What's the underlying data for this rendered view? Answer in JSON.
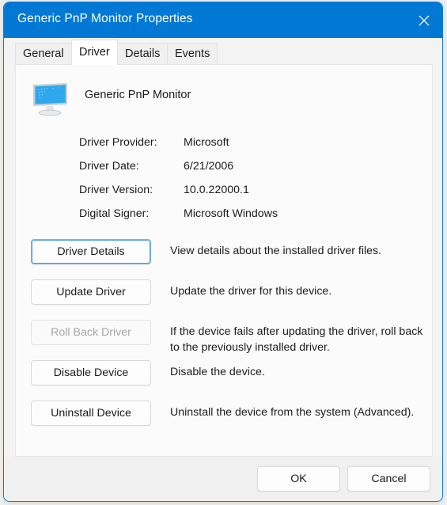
{
  "window": {
    "title": "Generic PnP Monitor Properties",
    "close_icon": "close-icon",
    "accent_color": "#0078d4",
    "border_color": "#1579c8"
  },
  "tabs": [
    {
      "label": "General",
      "active": false
    },
    {
      "label": "Driver",
      "active": true
    },
    {
      "label": "Details",
      "active": false
    },
    {
      "label": "Events",
      "active": false
    }
  ],
  "device": {
    "name": "Generic PnP Monitor",
    "icon": "monitor-icon"
  },
  "driver_info": [
    {
      "label": "Driver Provider:",
      "value": "Microsoft"
    },
    {
      "label": "Driver Date:",
      "value": "6/21/2006"
    },
    {
      "label": "Driver Version:",
      "value": "10.0.22000.1"
    },
    {
      "label": "Digital Signer:",
      "value": "Microsoft Windows"
    }
  ],
  "actions": [
    {
      "label": "Driver Details",
      "description": "View details about the installed driver files.",
      "disabled": false,
      "focused": true
    },
    {
      "label": "Update Driver",
      "description": "Update the driver for this device.",
      "disabled": false,
      "focused": false
    },
    {
      "label": "Roll Back Driver",
      "description": "If the device fails after updating the driver, roll back to the previously installed driver.",
      "disabled": true,
      "focused": false
    },
    {
      "label": "Disable Device",
      "description": "Disable the device.",
      "disabled": false,
      "focused": false
    },
    {
      "label": "Uninstall Device",
      "description": "Uninstall the device from the system (Advanced).",
      "disabled": false,
      "focused": false
    }
  ],
  "footer": {
    "ok_label": "OK",
    "cancel_label": "Cancel"
  }
}
